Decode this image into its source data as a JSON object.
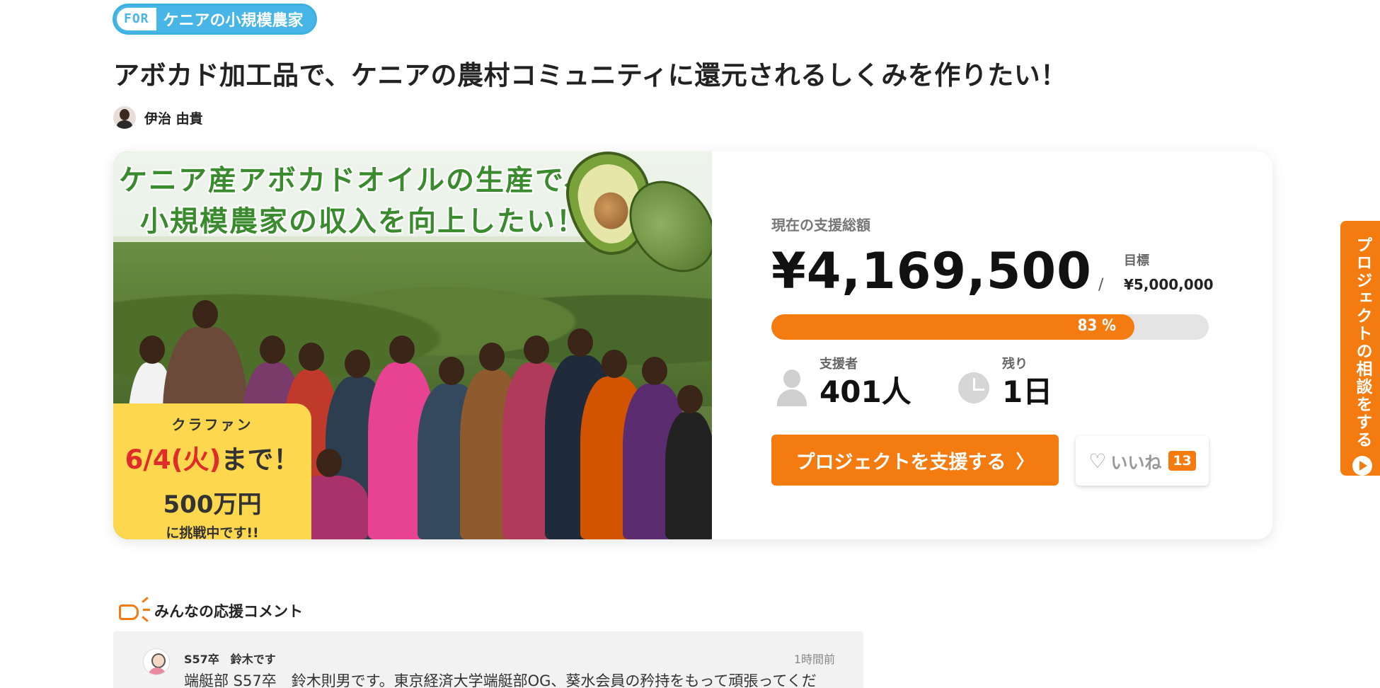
{
  "project": {
    "for_label": "FOR",
    "for_target": "ケニアの小規模農家",
    "title": "アボカド加工品で、ケニアの農村コミュニティに還元されるしくみを作りたい！",
    "author": "伊治 由貴"
  },
  "hero": {
    "headline_line1": "ケニア産アボカドオイルの生産で、",
    "headline_line2": "小規模農家の収入を向上したい！",
    "promo": {
      "label": "クラファン",
      "date": "6/4(火)",
      "until": "まで！",
      "amount": "500万円",
      "challenge": "に挑戦中です!!"
    }
  },
  "funding": {
    "current_label": "現在の支援総額",
    "current_amount": "¥4,169,500",
    "slash": "/",
    "goal_label": "目標",
    "goal_amount": "¥5,000,000",
    "progress_percent": 83,
    "progress_text": "83 %",
    "supporters_label": "支援者",
    "supporters_value": "401人",
    "remaining_label": "残り",
    "remaining_value": "1日",
    "support_button": "プロジェクトを支援する",
    "support_button_chevron": "〉",
    "like_label": "いいね",
    "like_count": "13"
  },
  "consult_tab": {
    "label": "プロジェクトの相談をする"
  },
  "comments": {
    "section_title": "みんなの応援コメント",
    "items": [
      {
        "name": "S57卒　鈴木です",
        "time": "1時間前",
        "text": "端艇部 S57卒　鈴木則男です。東京経済大学端艇部OG、葵水会員の矜持をもって頑張ってくだ"
      }
    ]
  },
  "colors": {
    "accent": "#f47b10",
    "for_tag": "#47b5e6",
    "promo_bg": "#fdd84e",
    "promo_red": "#e02b2b",
    "headline_green": "#3a8a2e"
  }
}
